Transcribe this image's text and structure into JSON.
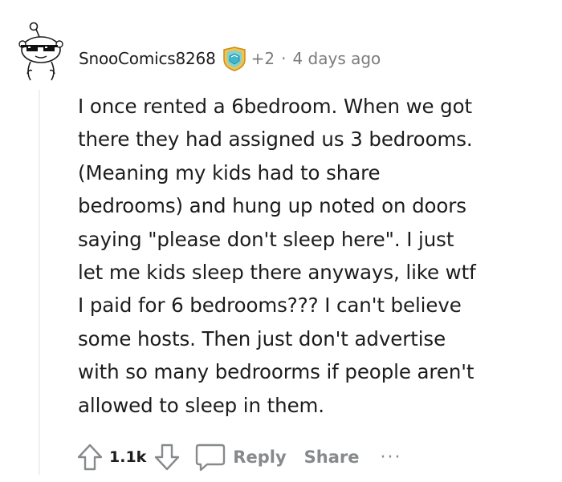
{
  "comment": {
    "username": "SnooComics8268",
    "karma_delta": "+2",
    "separator": "·",
    "timestamp": "4 days ago",
    "body": "I once rented a 6bedroom. When we got\nthere they had assigned us 3 bedrooms.\n(Meaning my kids had to share\nbedrooms) and hung up noted on doors\nsaying \"please don't sleep here\". I just\nlet me kids sleep there anyways, like wtf\nI paid for 6 bedrooms??? I can't believe\nsome hosts. Then just don't advertise\nwith so many bedroorms if people aren't\nallowed to sleep in them.",
    "score": "1.1k"
  },
  "actions": {
    "reply_label": "Reply",
    "share_label": "Share",
    "more_label": "···"
  },
  "icons": {
    "avatar": "snoo-avatar-sunglasses",
    "award": "award-icon",
    "upvote": "upvote-arrow-icon",
    "downvote": "downvote-arrow-icon",
    "reply": "speech-bubble-icon"
  },
  "colors": {
    "text": "#1c1c1c",
    "muted": "#7c7c7c",
    "action": "#878a8c",
    "thread_line": "#edeff1"
  }
}
